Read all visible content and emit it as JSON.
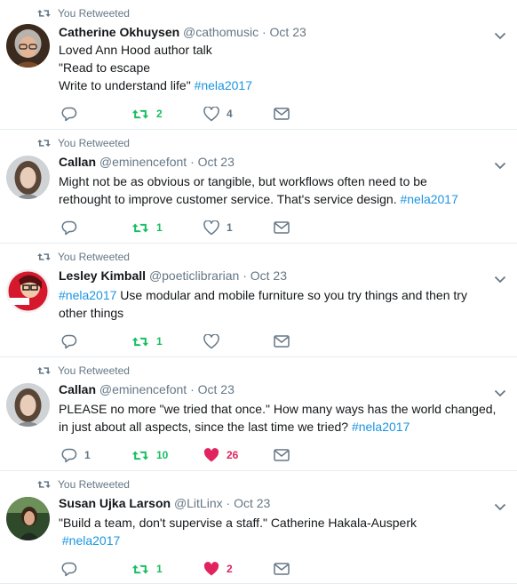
{
  "retweet_label": "You Retweeted",
  "colors": {
    "link": "#1b95e0",
    "retweet_active": "#17bf63",
    "like_active": "#e0245e",
    "muted": "#657786"
  },
  "tweets": [
    {
      "name": "Catherine Okhuysen",
      "handle": "@cathomusic",
      "dot": "·",
      "time": "Oct 23",
      "lines": [
        [
          {
            "t": "Loved Ann Hood author talk"
          }
        ],
        [
          {
            "t": "\"Read to escape"
          }
        ],
        [
          {
            "t": "Write to understand life\" "
          },
          {
            "t": "#nela2017",
            "tag": true
          }
        ]
      ],
      "reply_count": "",
      "retweet_count": "2",
      "like_count": "4",
      "liked": false
    },
    {
      "name": "Callan",
      "handle": "@eminencefont",
      "dot": "·",
      "time": "Oct 23",
      "lines": [
        [
          {
            "t": "Might not be as obvious or tangible, but workflows often need to be"
          }
        ],
        [
          {
            "t": "rethought to improve customer service. That's service design. "
          },
          {
            "t": "#nela2017",
            "tag": true
          }
        ]
      ],
      "reply_count": "",
      "retweet_count": "1",
      "like_count": "1",
      "liked": false
    },
    {
      "name": "Lesley Kimball",
      "handle": "@poeticlibrarian",
      "dot": "·",
      "time": "Oct 23",
      "lines": [
        [
          {
            "t": "#nela2017",
            "tag": true
          },
          {
            "t": " Use modular and mobile furniture so you try things and then try"
          }
        ],
        [
          {
            "t": "other things"
          }
        ]
      ],
      "reply_count": "",
      "retweet_count": "1",
      "like_count": "",
      "liked": false
    },
    {
      "name": "Callan",
      "handle": "@eminencefont",
      "dot": "·",
      "time": "Oct 23",
      "lines": [
        [
          {
            "t": "PLEASE no more \"we tried that once.\" How many ways has the world changed,"
          }
        ],
        [
          {
            "t": "in just about all aspects, since the last time we tried? "
          },
          {
            "t": "#nela2017",
            "tag": true
          }
        ]
      ],
      "reply_count": "1",
      "retweet_count": "10",
      "like_count": "26",
      "liked": true
    },
    {
      "name": "Susan Ujka Larson",
      "handle": "@LitLinx",
      "dot": "·",
      "time": "Oct 23",
      "lines": [
        [
          {
            "t": "\"Build a team, don't supervise a staff.\" Catherine Hakala-Ausperk"
          }
        ],
        [
          {
            "t": " "
          },
          {
            "t": "#nela2017",
            "tag": true
          }
        ]
      ],
      "reply_count": "",
      "retweet_count": "1",
      "like_count": "2",
      "liked": true
    }
  ]
}
